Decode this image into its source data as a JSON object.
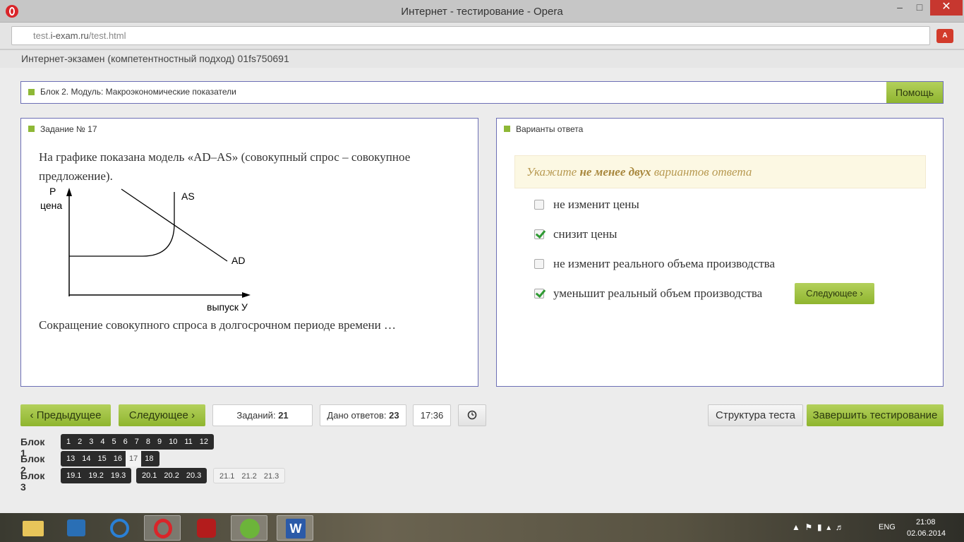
{
  "window": {
    "title": "Интернет - тестирование - Opera",
    "url_prefix": "test.",
    "url_domain": "i-exam.ru",
    "url_path": "/test.html"
  },
  "exam": {
    "header": "Интернет-экзамен (компетентностный подход) 01fs750691",
    "block_title": "Блок 2. Модуль: Макроэкономические показатели",
    "help_label": "Помощь"
  },
  "task": {
    "heading": "Задание № 17",
    "intro": "На графике показана модель «AD–AS» (совокупный спрос – совокупное предложение).",
    "question": "Сокращение совокупного спроса в долгосрочном периоде времени …"
  },
  "chart_data": {
    "type": "diagram",
    "y_axis_label_letter": "P",
    "y_axis_label": "цена",
    "x_axis_label": "выпуск У",
    "curves": [
      "AS",
      "AD"
    ]
  },
  "answers": {
    "heading": "Варианты ответа",
    "hint_prefix": "Укажите ",
    "hint_bold": "не менее двух",
    "hint_suffix": " вариантов ответа",
    "options": [
      {
        "label": "не изменит цены",
        "checked": false
      },
      {
        "label": "снизит цены",
        "checked": true
      },
      {
        "label": "не изменит реального объема производства",
        "checked": false
      },
      {
        "label": "уменьшит реальный объем производства",
        "checked": true
      }
    ],
    "next_label": "Следующее"
  },
  "toolbar": {
    "prev_label": "Предыдущее",
    "next_label": "Следующее",
    "tasks_label": "Заданий:",
    "tasks_value": "21",
    "answers_label": "Дано ответов:",
    "answers_value": "23",
    "time": "17:36",
    "structure_label": "Структура теста",
    "finish_label": "Завершить тестирование"
  },
  "navigation": {
    "block1_label": "Блок 1",
    "block1": [
      "1",
      "2",
      "3",
      "4",
      "5",
      "6",
      "7",
      "8",
      "9",
      "10",
      "11",
      "12"
    ],
    "block2_label": "Блок 2",
    "block2_a": [
      "13",
      "14",
      "15",
      "16"
    ],
    "block2_current": "17",
    "block2_b": [
      "18"
    ],
    "block3_label": "Блок 3",
    "block3_a": [
      "19.1",
      "19.2",
      "19.3"
    ],
    "block3_b": [
      "20.1",
      "20.2",
      "20.3"
    ],
    "block3_c": [
      "21.1",
      "21.2",
      "21.3"
    ]
  },
  "tray": {
    "lang": "ENG",
    "time": "21:08",
    "date": "02.06.2014"
  },
  "colors": {
    "accent_green": "#8fb52f",
    "panel_border": "#6d6fb5",
    "hint_bg": "#fcf8e3"
  }
}
